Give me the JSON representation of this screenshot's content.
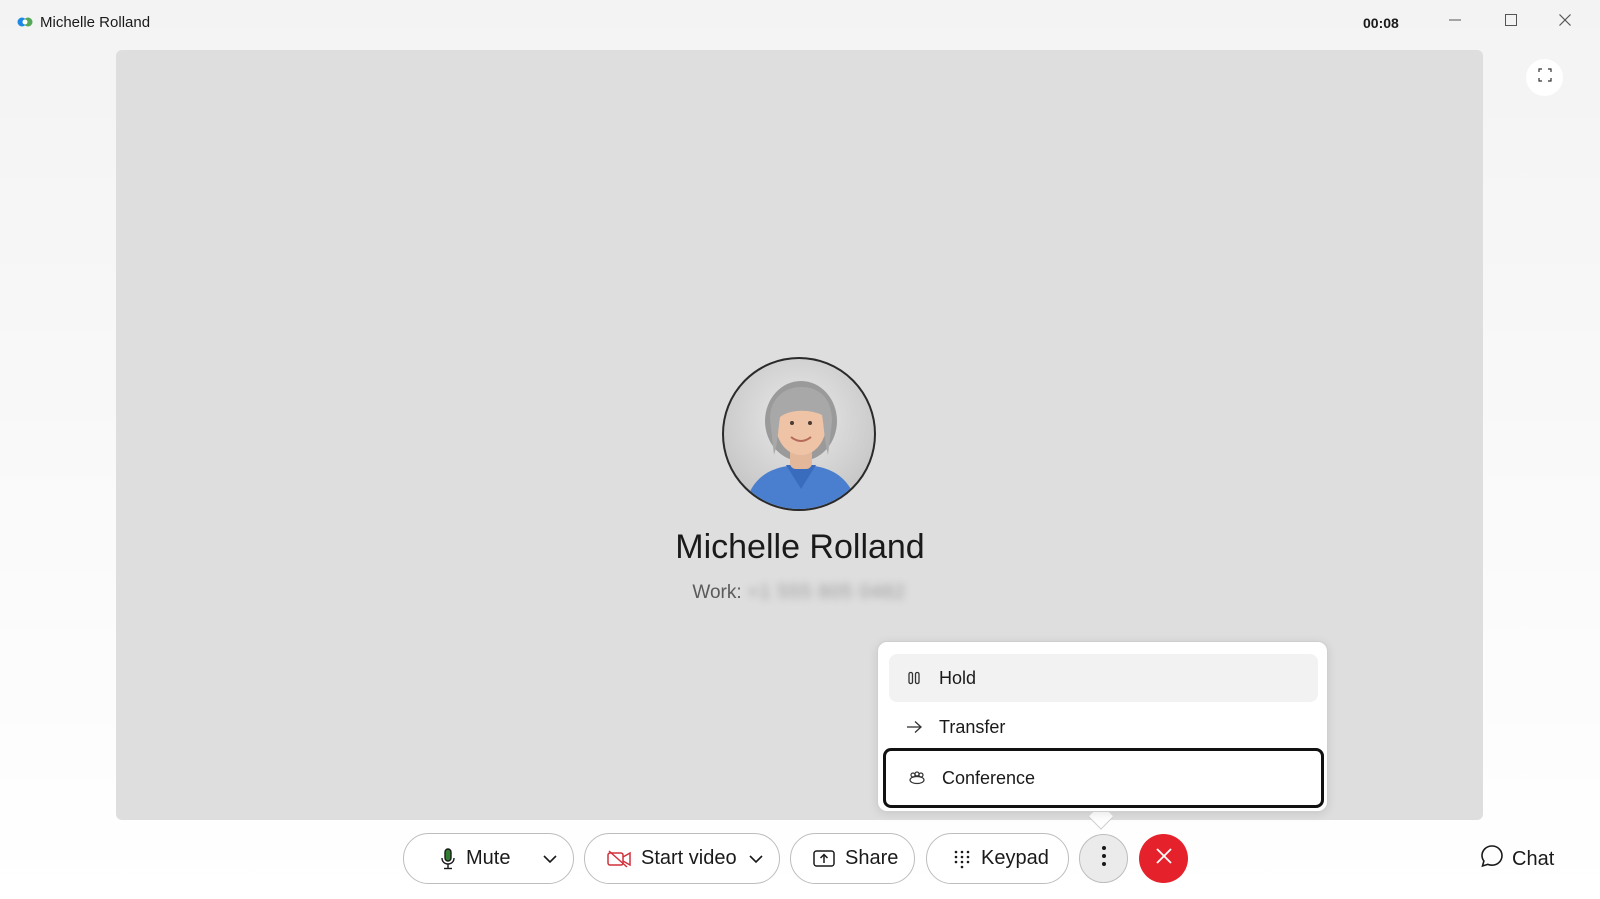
{
  "window": {
    "title": "Michelle Rolland",
    "timer": "00:08",
    "icons": {
      "app": "webex-logo-icon",
      "minimize": "minimize-icon",
      "maximize": "maximize-icon",
      "close": "close-icon"
    }
  },
  "stage": {
    "fullscreen_icon": "fullscreen-icon",
    "contact": {
      "name": "Michelle Rolland",
      "number_label": "Work:",
      "number_value": "+1 555 805 0482"
    }
  },
  "menu": {
    "items": [
      {
        "label": "Hold",
        "icon": "pause-icon"
      },
      {
        "label": "Transfer",
        "icon": "arrow-right-icon"
      },
      {
        "label": "Conference",
        "icon": "conference-icon"
      }
    ]
  },
  "controls": {
    "mute_label": "Mute",
    "start_video_label": "Start video",
    "share_label": "Share",
    "keypad_label": "Keypad",
    "chat_label": "Chat",
    "more_icon": "more-vertical-icon",
    "end_icon": "end-call-icon"
  },
  "colors": {
    "stage": "#dedede",
    "end_call": "#e5222b",
    "video_off_icon": "#d1313b",
    "mic_icon": "#2e7d32"
  }
}
